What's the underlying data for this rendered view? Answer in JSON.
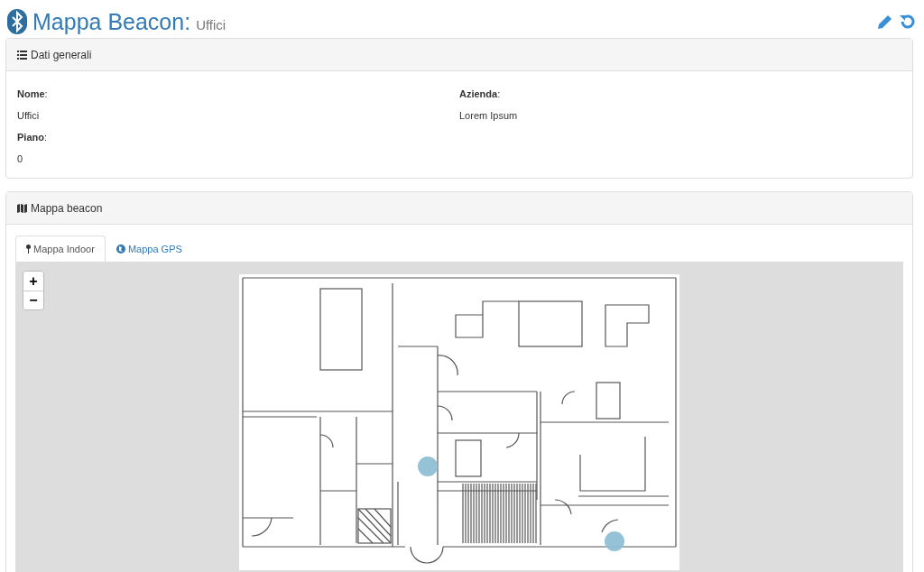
{
  "header": {
    "title": "Mappa Beacon:",
    "subtitle": "Uffici"
  },
  "general_panel": {
    "title": "Dati generali",
    "fields": [
      {
        "label": "**Nome**:",
        "value": "Uffici"
      },
      {
        "label": "**Azienda**:",
        "value": "Lorem Ipsum"
      },
      {
        "label": "**Piano**:",
        "value": "0"
      }
    ]
  },
  "map_panel": {
    "title": "Mappa beacon",
    "tabs": [
      {
        "label": "Mappa Indoor",
        "kind": "pin",
        "selected": true
      },
      {
        "label": "Mappa GPS",
        "kind": "globe",
        "selected": false
      }
    ],
    "zoom_controls": [
      "+",
      "−"
    ]
  }
}
